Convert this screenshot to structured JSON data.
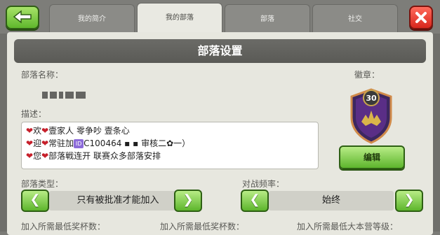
{
  "tabs": [
    {
      "label": "我的简介"
    },
    {
      "label": "我的部落"
    },
    {
      "label": "部落"
    },
    {
      "label": "社交"
    }
  ],
  "panel": {
    "title": "部落设置",
    "name_label": "部落名称：",
    "badge_label": "徽章：",
    "badge_level": "30",
    "desc_label": "描述：",
    "description": {
      "line1": "欢",
      "line1b": "壹家人  零争吵  壹条心",
      "line2": "迎",
      "line2b": "常驻加",
      "line2c": "C100464",
      "line2d": "审核二",
      "line2e": "一）",
      "line3": "您",
      "line3b": "部落戦连开 联赛众多部落安排"
    },
    "edit_label": "编辑",
    "clan_type_label": "部落类型：",
    "clan_type_value": "只有被批准才能加入",
    "war_freq_label": "对战频率：",
    "war_freq_value": "始终",
    "min_trophies_label": "加入所需最低奖杯数：",
    "min_trophies_label2": "加入所需最低奖杯数：",
    "min_th_label": "加入所需最低大本营等级："
  },
  "icons": {
    "back": "back-arrow-icon",
    "close": "close-x-icon"
  },
  "colors": {
    "green_button": "#5db52c",
    "red_button": "#d8261c",
    "badge_purple": "#5a2e86",
    "badge_gold": "#d9b54a"
  }
}
